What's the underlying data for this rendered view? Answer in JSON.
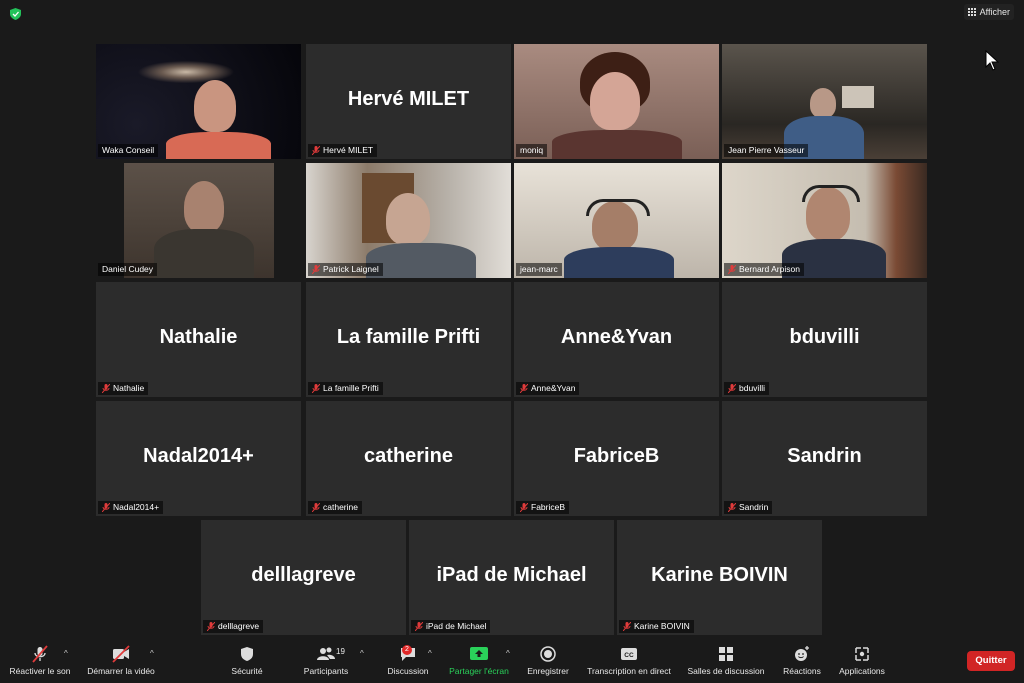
{
  "topbar": {
    "view_label": "Afficher"
  },
  "participants": [
    {
      "big": "",
      "tag": "Waka Conseil",
      "muted": false
    },
    {
      "big": "Hervé MILET",
      "tag": "Hervé MILET",
      "muted": true
    },
    {
      "big": "",
      "tag": "moniq",
      "muted": false
    },
    {
      "big": "",
      "tag": "Jean Pierre Vasseur",
      "muted": false
    },
    {
      "big": "",
      "tag": "Daniel Cudey",
      "muted": false
    },
    {
      "big": "",
      "tag": "Patrick Laignel",
      "muted": true
    },
    {
      "big": "",
      "tag": "jean-marc",
      "muted": false
    },
    {
      "big": "",
      "tag": "Bernard Arpison",
      "muted": true
    },
    {
      "big": "Nathalie",
      "tag": "Nathalie",
      "muted": true
    },
    {
      "big": "La famille Prifti",
      "tag": "La famille Prifti",
      "muted": true
    },
    {
      "big": "Anne&Yvan",
      "tag": "Anne&Yvan",
      "muted": true
    },
    {
      "big": "bduvilli",
      "tag": "bduvilli",
      "muted": true
    },
    {
      "big": "Nadal2014+",
      "tag": "Nadal2014+",
      "muted": true
    },
    {
      "big": "catherine",
      "tag": "catherine",
      "muted": true
    },
    {
      "big": "FabriceB",
      "tag": "FabriceB",
      "muted": true
    },
    {
      "big": "Sandrin",
      "tag": "Sandrin",
      "muted": true
    },
    {
      "big": "delllagreve",
      "tag": "delllagreve",
      "muted": true
    },
    {
      "big": "iPad de Michael",
      "tag": "iPad de Michael",
      "muted": true
    },
    {
      "big": "Karine BOIVIN",
      "tag": "Karine BOIVIN",
      "muted": true
    }
  ],
  "toolbar": {
    "unmute": "Réactiver le son",
    "start_video": "Démarrer la vidéo",
    "security": "Sécurité",
    "participants": "Participants",
    "participants_count": "19",
    "chat": "Discussion",
    "chat_badge": "2",
    "share": "Partager l'écran",
    "record": "Enregistrer",
    "transcription": "Transcription en direct",
    "breakout": "Salles de discussion",
    "reactions": "Réactions",
    "apps": "Applications",
    "quit": "Quitter"
  },
  "colors": {
    "active_speaker": "#d9e86a",
    "share_green": "#2ad15a",
    "quit_red": "#d12525"
  }
}
